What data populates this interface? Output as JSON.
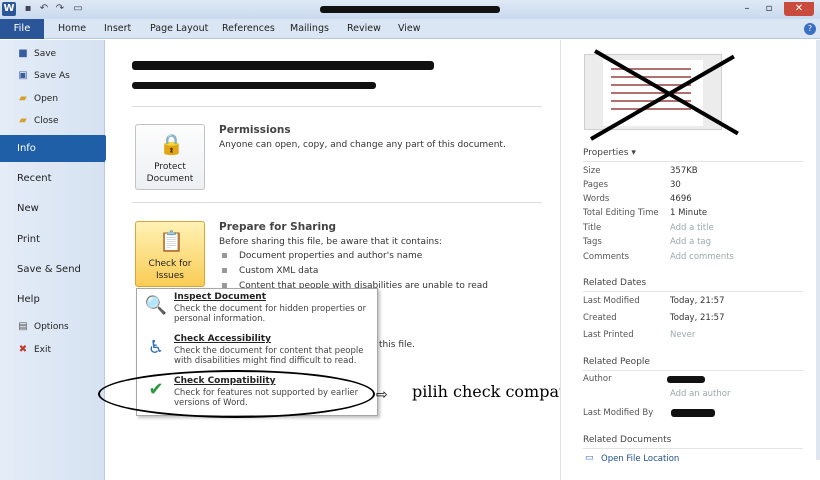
{
  "title_bar": {
    "app_icon_letter": "W",
    "quick_access_icons": [
      "save-icon",
      "undo-icon",
      "redo-icon",
      "new-document-icon"
    ],
    "window_controls": [
      "minimize-icon",
      "restore-icon",
      "close-icon"
    ]
  },
  "ribbon": {
    "file_tab": "File",
    "tabs": [
      "Home",
      "Insert",
      "Page Layout",
      "References",
      "Mailings",
      "Review",
      "View"
    ]
  },
  "nav": {
    "small_top": [
      {
        "label": "Save",
        "icon": "save-icon"
      },
      {
        "label": "Save As",
        "icon": "save-as-icon"
      },
      {
        "label": "Open",
        "icon": "open-folder-icon"
      },
      {
        "label": "Close",
        "icon": "close-document-icon"
      }
    ],
    "big": [
      "Info",
      "Recent",
      "New",
      "Print",
      "Save & Send",
      "Help"
    ],
    "active": "Info",
    "small_bottom": [
      {
        "label": "Options",
        "icon": "options-icon"
      },
      {
        "label": "Exit",
        "icon": "exit-icon"
      }
    ]
  },
  "permissions": {
    "button_label": "Protect Document",
    "title": "Permissions",
    "text": "Anyone can open, copy, and change any part of this document."
  },
  "sharing": {
    "button_label": "Check for Issues",
    "title": "Prepare for Sharing",
    "intro": "Before sharing this file, be aware that it contains:",
    "items": [
      "Document properties and author's name",
      "Custom XML data",
      "Content that people with disabilities are unable to read"
    ]
  },
  "versions_partial_text": "f this file.",
  "dropdown": [
    {
      "title": "Inspect Document",
      "desc": "Check the document for hidden properties or personal information.",
      "icon": "inspect-document-icon"
    },
    {
      "title": "Check Accessibility",
      "desc": "Check the document for content that people with disabilities might find difficult to read.",
      "icon": "accessibility-icon"
    },
    {
      "title": "Check Compatibility",
      "desc": "Check for features not supported by earlier versions of Word.",
      "icon": "compatibility-icon"
    }
  ],
  "annotation": {
    "arrow": "⇨",
    "text": "pilih check compatibility"
  },
  "properties": {
    "header": "Properties ▾",
    "rows": [
      {
        "key": "Size",
        "value": "357KB"
      },
      {
        "key": "Pages",
        "value": "30"
      },
      {
        "key": "Words",
        "value": "4696"
      },
      {
        "key": "Total Editing Time",
        "value": "1 Minute"
      },
      {
        "key": "Title",
        "value": "Add a title",
        "placeholder": true
      },
      {
        "key": "Tags",
        "value": "Add a tag",
        "placeholder": true
      },
      {
        "key": "Comments",
        "value": "Add comments",
        "placeholder": true
      }
    ]
  },
  "related_dates": {
    "header": "Related Dates",
    "rows": [
      {
        "key": "Last Modified",
        "value": "Today, 21:57"
      },
      {
        "key": "Created",
        "value": "Today, 21:57"
      },
      {
        "key": "Last Printed",
        "value": "Never",
        "placeholder": true
      }
    ]
  },
  "related_people": {
    "header": "Related People",
    "author_label": "Author",
    "add_author": "Add an author",
    "last_modified_by_label": "Last Modified By"
  },
  "related_documents": {
    "header": "Related Documents",
    "open_location": "Open File Location"
  }
}
